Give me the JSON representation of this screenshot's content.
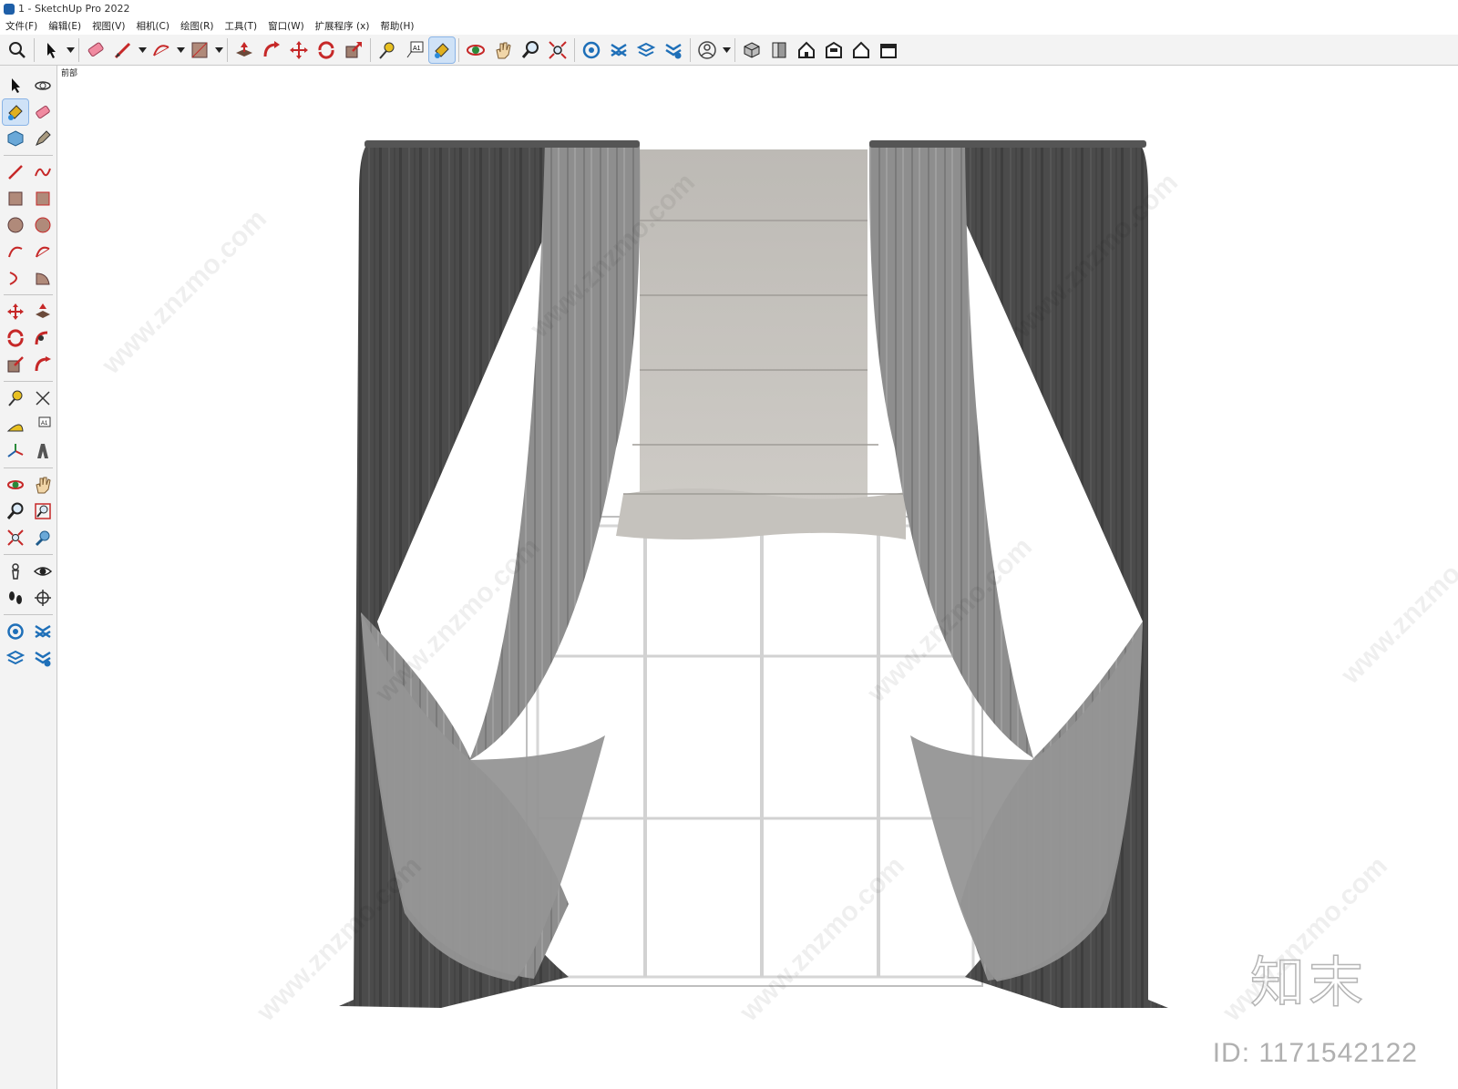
{
  "window": {
    "title": "1 - SketchUp Pro 2022"
  },
  "menu": [
    "文件(F)",
    "编辑(E)",
    "视图(V)",
    "相机(C)",
    "绘图(R)",
    "工具(T)",
    "窗口(W)",
    "扩展程序 (x)",
    "帮助(H)"
  ],
  "viewport": {
    "scene_label": "前部"
  },
  "watermark": {
    "site": "www.znzmo.com",
    "cn": "知末网",
    "brand": "知末",
    "id_text": "ID: 1171542122"
  },
  "colors": {
    "curtain_dark": "#4a4a4a",
    "curtain_light": "#8f8f8f",
    "shade": "#c9c7c2",
    "frame": "#d9d9d9",
    "active_tool": "#cfe2f7"
  }
}
